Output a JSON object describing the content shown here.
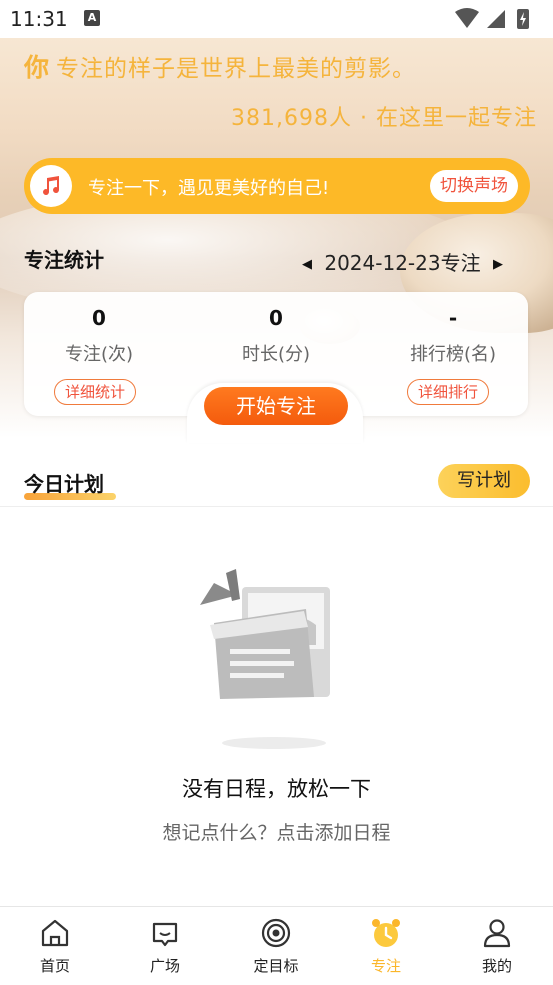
{
  "status_bar": {
    "time": "11:31",
    "notif_icon": "a-icon"
  },
  "hero": {
    "slogan_lead": "你",
    "slogan_rest": "专注的样子是世界上最美的剪影。",
    "counter": "381,698人 · 在这里一起专注"
  },
  "sound": {
    "message": "专注一下，遇见更美好的自己!",
    "switch_label": "切换声场",
    "icon": "music-note-icon"
  },
  "stats_section": {
    "title": "专注统计",
    "date": "2024-12-23专注",
    "items": [
      {
        "value": "0",
        "label": "专注(次)"
      },
      {
        "value": "0",
        "label": "时长(分)"
      },
      {
        "value": "-",
        "label": "排行榜(名)"
      }
    ],
    "detail_stats": "详细统计",
    "detail_rank": "详细排行",
    "start_button": "开始专注"
  },
  "plan_section": {
    "title": "今日计划",
    "write_button": "写计划"
  },
  "empty_state": {
    "title": "没有日程，放松一下",
    "subtitle": "想记点什么？点击添加日程"
  },
  "tabs": [
    {
      "label": "首页",
      "icon": "home-icon"
    },
    {
      "label": "广场",
      "icon": "chat-icon"
    },
    {
      "label": "定目标",
      "icon": "target-icon"
    },
    {
      "label": "专注",
      "icon": "alarm-clock-icon"
    },
    {
      "label": "我的",
      "icon": "user-icon"
    }
  ],
  "colors": {
    "accent": "#fbb62a",
    "orange": "#f45b0d",
    "red_text": "#f0533c"
  }
}
